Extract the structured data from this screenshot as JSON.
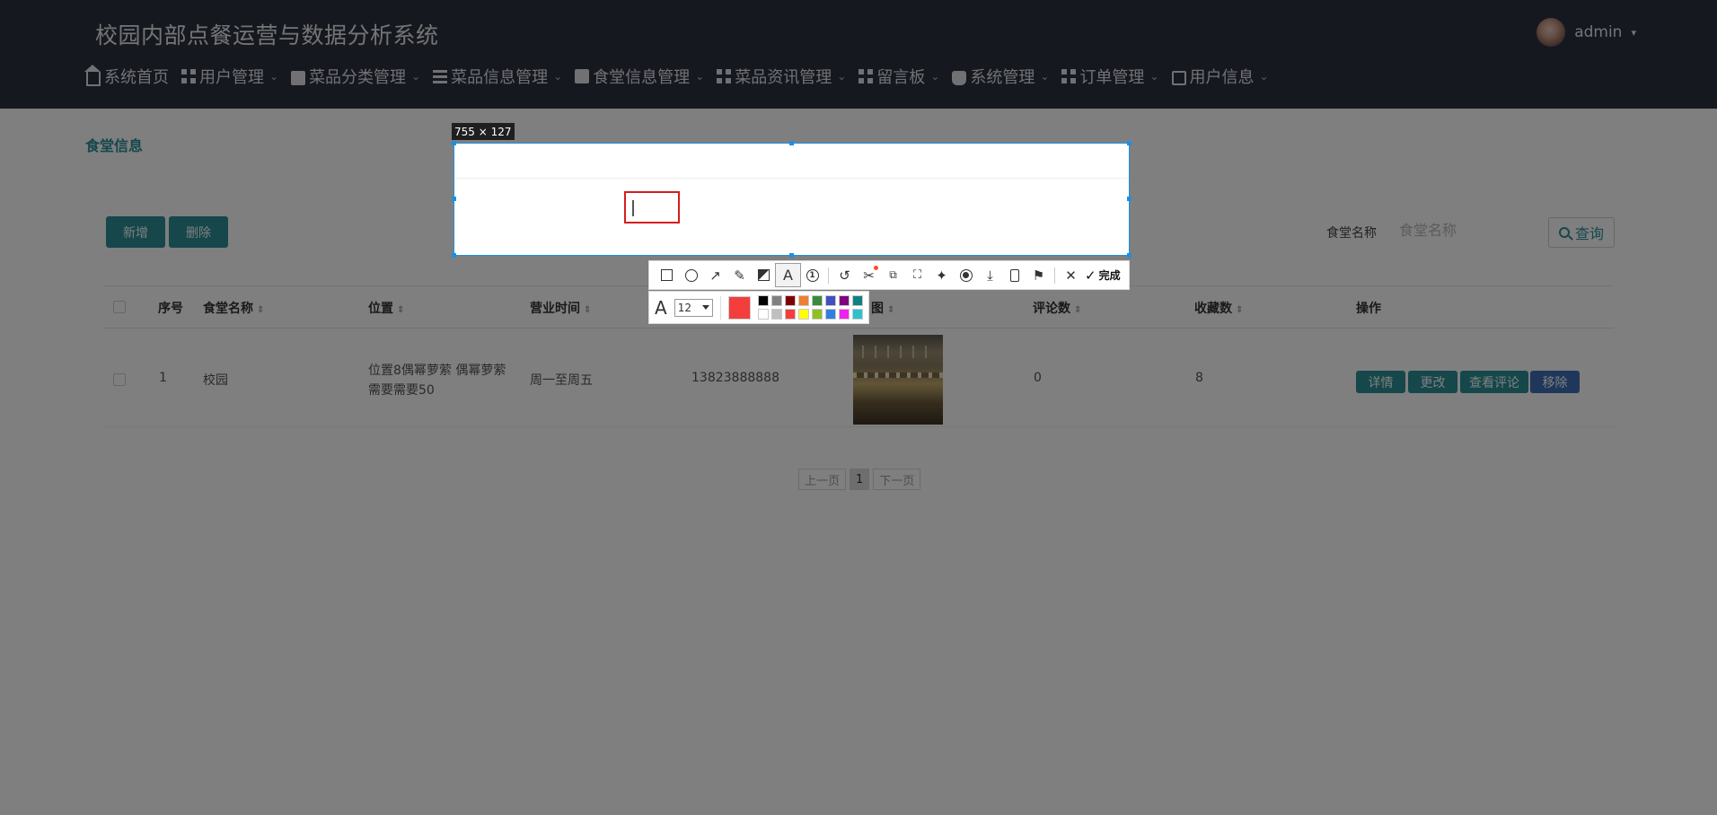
{
  "app": {
    "title": "校园内部点餐运营与数据分析系统"
  },
  "user": {
    "name": "admin",
    "caret": "▾"
  },
  "nav": [
    {
      "label": "系统首页",
      "icon": "home-icon",
      "has_caret": false
    },
    {
      "label": "用户管理",
      "icon": "grid-icon",
      "has_caret": true
    },
    {
      "label": "菜品分类管理",
      "icon": "bag-icon",
      "has_caret": true
    },
    {
      "label": "菜品信息管理",
      "icon": "list-icon",
      "has_caret": true
    },
    {
      "label": "食堂信息管理",
      "icon": "clipboard-icon",
      "has_caret": true
    },
    {
      "label": "菜品资讯管理",
      "icon": "grid-icon",
      "has_caret": true
    },
    {
      "label": "留言板",
      "icon": "grid-icon",
      "has_caret": true
    },
    {
      "label": "系统管理",
      "icon": "cup-icon",
      "has_caret": true
    },
    {
      "label": "订单管理",
      "icon": "grid-icon",
      "has_caret": true
    },
    {
      "label": "用户信息",
      "icon": "card-icon",
      "has_caret": true
    }
  ],
  "breadcrumb": "食堂信息",
  "toolbar": {
    "add_label": "新增",
    "delete_label": "删除"
  },
  "search": {
    "label": "食堂名称",
    "placeholder": "食堂名称",
    "button_label": "查询"
  },
  "table": {
    "headers": [
      "序号",
      "食堂名称",
      "位置",
      "营业时间",
      "",
      "图",
      "评论数",
      "收藏数",
      "操作"
    ],
    "sortable_icon": "⇕",
    "rows": [
      {
        "index": "1",
        "name": "校园",
        "location_line1": "位置8偶幂萝萦 偶幂萝萦",
        "location_line2": "需要需要50",
        "hours": "周一至周五",
        "phone": "13823888888",
        "comments": "0",
        "favorites": "8",
        "actions": [
          "详情",
          "更改",
          "查看评论",
          "移除"
        ]
      }
    ]
  },
  "pager": {
    "prev": "上一页",
    "current": "1",
    "next": "下一页"
  },
  "capture": {
    "size_label": "755 × 127",
    "done_label": "完成",
    "font_size": "12",
    "current_color": "#f43d3d",
    "palette": [
      "#000000",
      "#808080",
      "#800000",
      "#f08030",
      "#3a8a3a",
      "#4050c0",
      "#800080",
      "#108080",
      "#ffffff",
      "#c0c0c0",
      "#f43d3d",
      "#ffff00",
      "#90c020",
      "#3080e0",
      "#f020f0",
      "#30c0d0"
    ],
    "tools": [
      "rectangle-icon",
      "circle-icon",
      "arrow-icon",
      "pencil-icon",
      "mosaic-icon",
      "text-icon",
      "number-icon",
      "undo-icon",
      "scissors-icon",
      "translate-icon",
      "scan-icon",
      "pin-icon",
      "record-icon",
      "download-icon",
      "phone-icon",
      "bookmark-icon",
      "cancel-icon",
      "check-icon"
    ]
  }
}
